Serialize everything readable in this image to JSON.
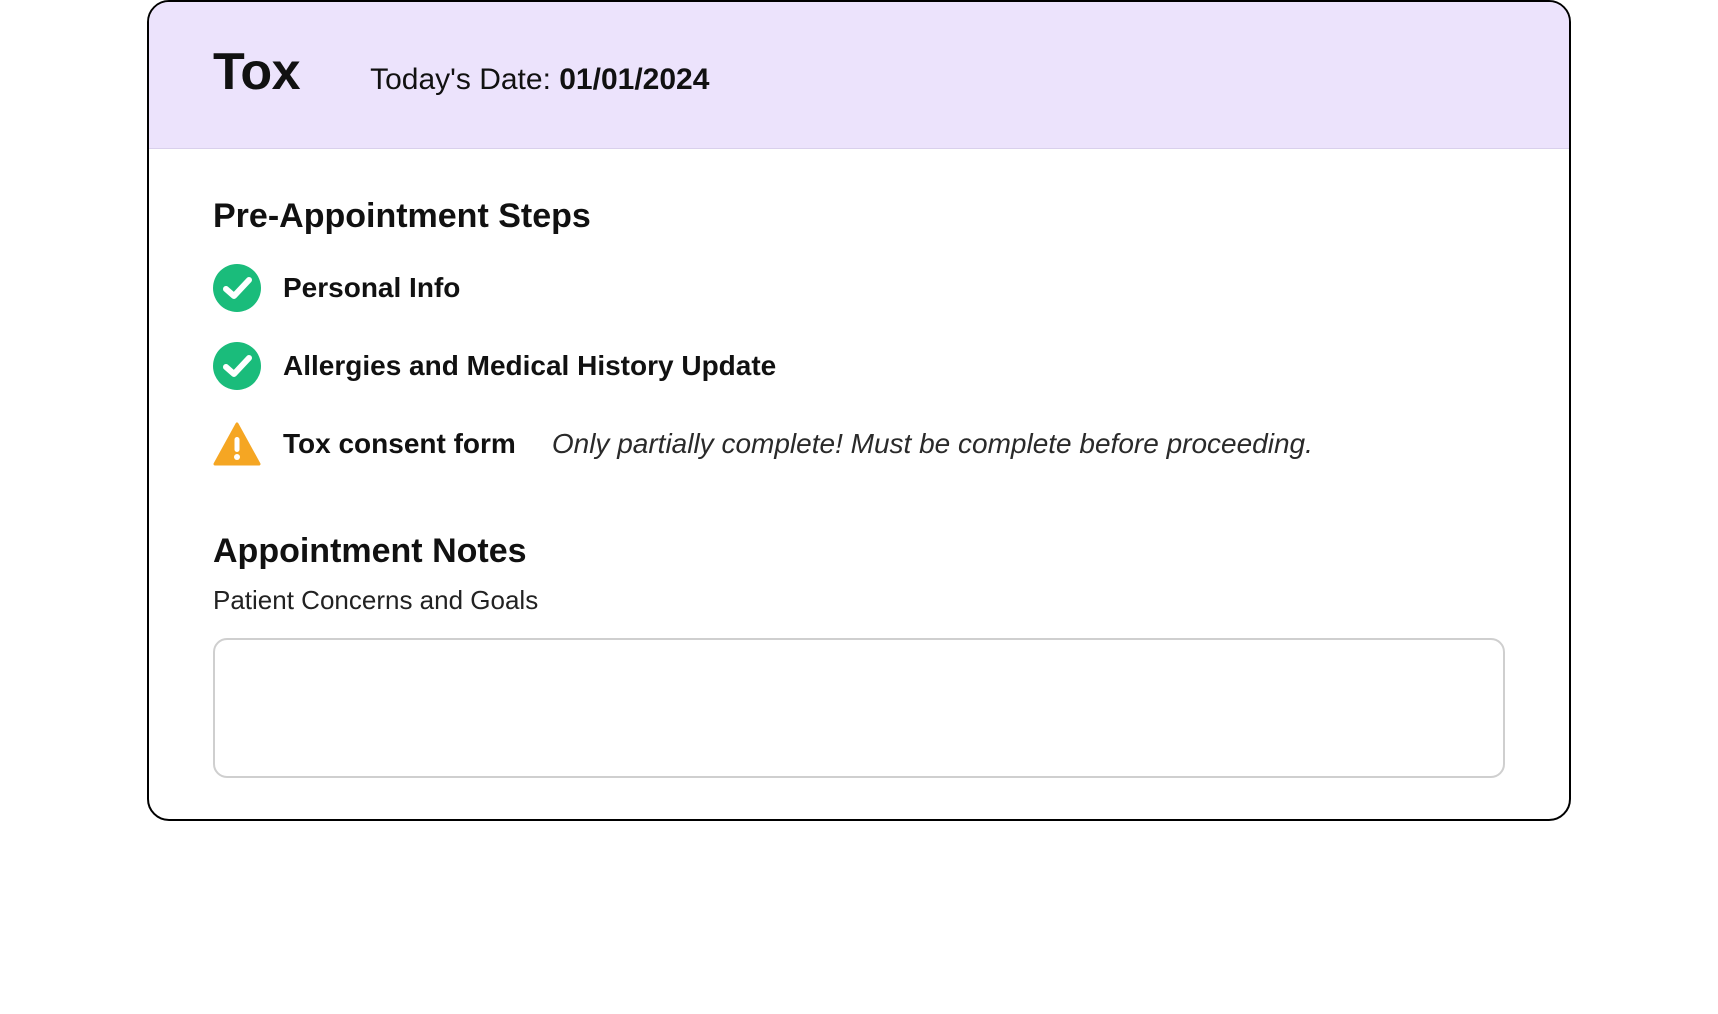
{
  "header": {
    "title": "Tox",
    "date_label": "Today's Date: ",
    "date_value": "01/01/2024"
  },
  "pre_steps": {
    "heading": "Pre-Appointment Steps",
    "items": [
      {
        "status": "done",
        "label": "Personal Info",
        "message": ""
      },
      {
        "status": "done",
        "label": "Allergies and Medical History Update",
        "message": ""
      },
      {
        "status": "warning",
        "label": "Tox consent form",
        "message": "Only partially complete! Must be complete before proceeding."
      }
    ]
  },
  "notes": {
    "heading": "Appointment Notes",
    "field_label": "Patient Concerns and Goals",
    "value": ""
  },
  "colors": {
    "header_bg": "#ECE3FC",
    "success": "#1ABC7B",
    "warning": "#F5A623"
  }
}
